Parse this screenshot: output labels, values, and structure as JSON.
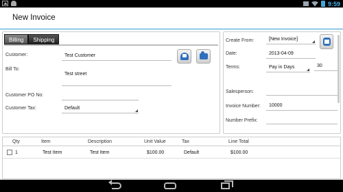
{
  "status_bar": {
    "time": "9:59"
  },
  "title": "New Invoice",
  "tabs": [
    "Billing",
    "Shipping"
  ],
  "billing": {
    "customer_label": "Customer:",
    "customer_value": "Test Customer",
    "bill_to_label": "Bill To:",
    "bill_to_value": "Test street",
    "po_label": "Customer PO No:",
    "po_value": "",
    "tax_label": "Customer Tax:",
    "tax_value": "Default"
  },
  "invoice_info": {
    "create_from_label": "Create From:",
    "create_from_value": "[New Invoice]",
    "date_label": "Date:",
    "date_value": "2013-04-09",
    "terms_label": "Terms:",
    "terms_value": "Pay in Days",
    "terms_days": "30",
    "salesperson_label": "Salesperson:",
    "salesperson_value": "",
    "invoice_number_label": "Invoice Number:",
    "invoice_number_value": "10000",
    "number_prefix_label": "Number Prefix:",
    "number_prefix_value": ""
  },
  "lines_table": {
    "columns": [
      "Qty",
      "Item",
      "Description",
      "Unit Value",
      "Tax",
      "Line Total"
    ],
    "rows": [
      {
        "qty": "1",
        "item": "Test Item",
        "description": "Test Item",
        "unit_value": "$100.00",
        "tax": "Default",
        "line_total": "$100.00"
      }
    ]
  },
  "icons": {
    "customer_lookup": "address-book-icon",
    "add_customer": "add-contact-icon",
    "date_picker": "calendar-icon",
    "back": "back-icon",
    "home": "home-icon",
    "recents": "recent-apps-icon"
  },
  "colors": {
    "accent": "#2c9bd1",
    "clock": "#45b0e8"
  }
}
